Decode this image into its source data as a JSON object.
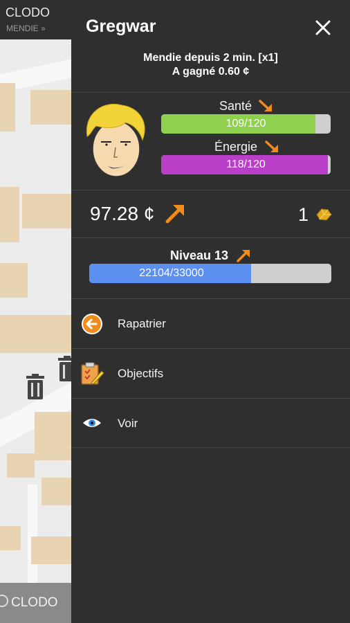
{
  "map": {
    "app_title": "CLODO",
    "subtitle": "MENDIE »",
    "bottom_label": "CLODO"
  },
  "drawer": {
    "player_name": "Gregwar",
    "status_line1": "Mendie depuis 2 min. [x1]",
    "status_line2": "A gagné 0.60 ¢",
    "health": {
      "label": "Santé",
      "text": "109/120",
      "value": 109,
      "max": 120,
      "color": "#8fd14f",
      "trend": "down"
    },
    "energy": {
      "label": "Énergie",
      "text": "118/120",
      "value": 118,
      "max": 120,
      "color": "#b93fc8",
      "trend": "down"
    },
    "money": "97.28 ¢",
    "money_trend": "up",
    "gold": "1",
    "level": {
      "label": "Niveau 13",
      "text": "22104/33000",
      "value": 22104,
      "max": 33000,
      "color": "#5b8ff0",
      "trend": "up"
    },
    "menu": [
      {
        "label": "Rapatrier",
        "icon": "back-arrow-icon"
      },
      {
        "label": "Objectifs",
        "icon": "objectives-icon"
      },
      {
        "label": "Voir",
        "icon": "eye-icon"
      }
    ]
  },
  "colors": {
    "drawer_bg": "#2f2f2f",
    "accent_orange": "#f08c1e"
  }
}
